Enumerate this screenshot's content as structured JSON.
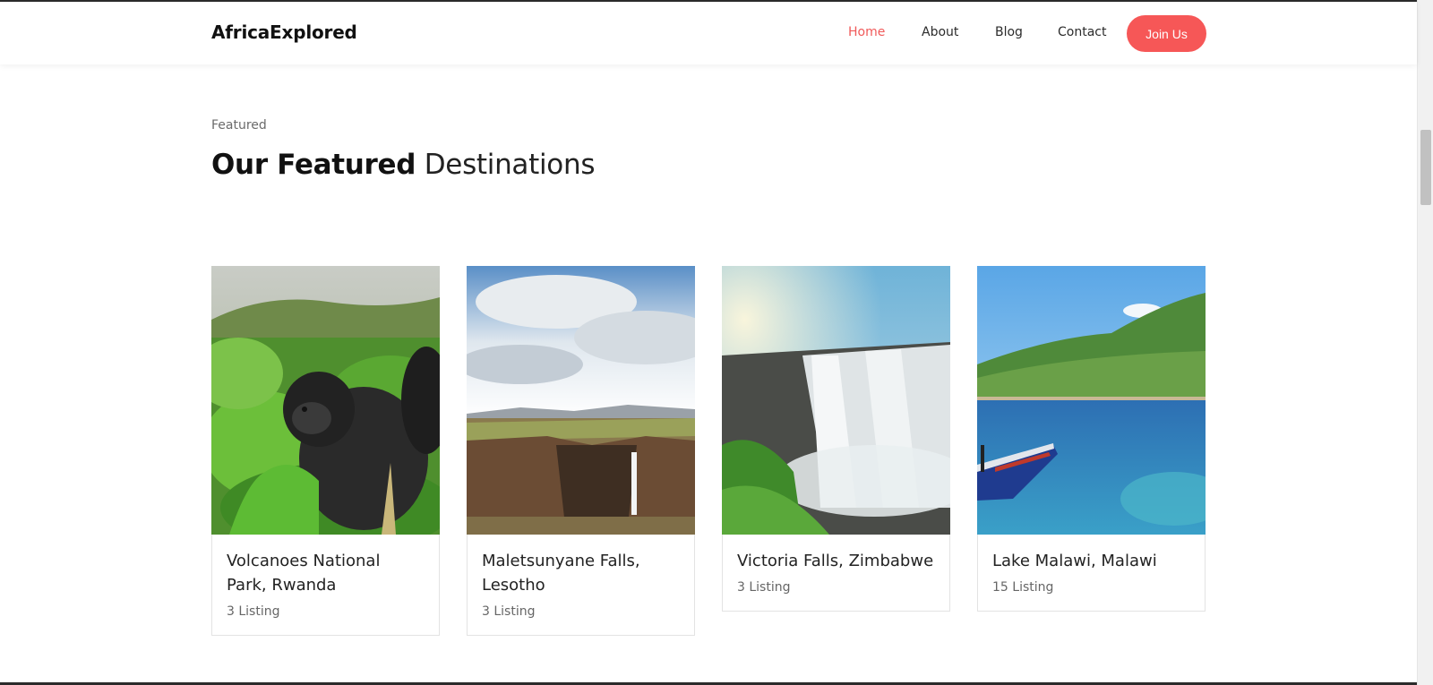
{
  "header": {
    "brand": "AfricaExplored",
    "nav": {
      "home": "Home",
      "about": "About",
      "blog": "Blog",
      "contact": "Contact"
    },
    "join_label": "Join Us",
    "accent_color": "#f65757"
  },
  "section": {
    "kicker": "Featured",
    "title_bold": "Our Featured",
    "title_light": " Destinations"
  },
  "destinations": [
    {
      "title": "Volcanoes National Park, Rwanda",
      "listings": "3 Listing",
      "icon": "gorilla-photo"
    },
    {
      "title": "Maletsunyane Falls, Lesotho",
      "listings": "3 Listing",
      "icon": "canyon-waterfall-photo"
    },
    {
      "title": "Victoria Falls, Zimbabwe",
      "listings": "3 Listing",
      "icon": "waterfall-photo"
    },
    {
      "title": "Lake Malawi, Malawi",
      "listings": "15 Listing",
      "icon": "lake-boat-photo"
    }
  ]
}
